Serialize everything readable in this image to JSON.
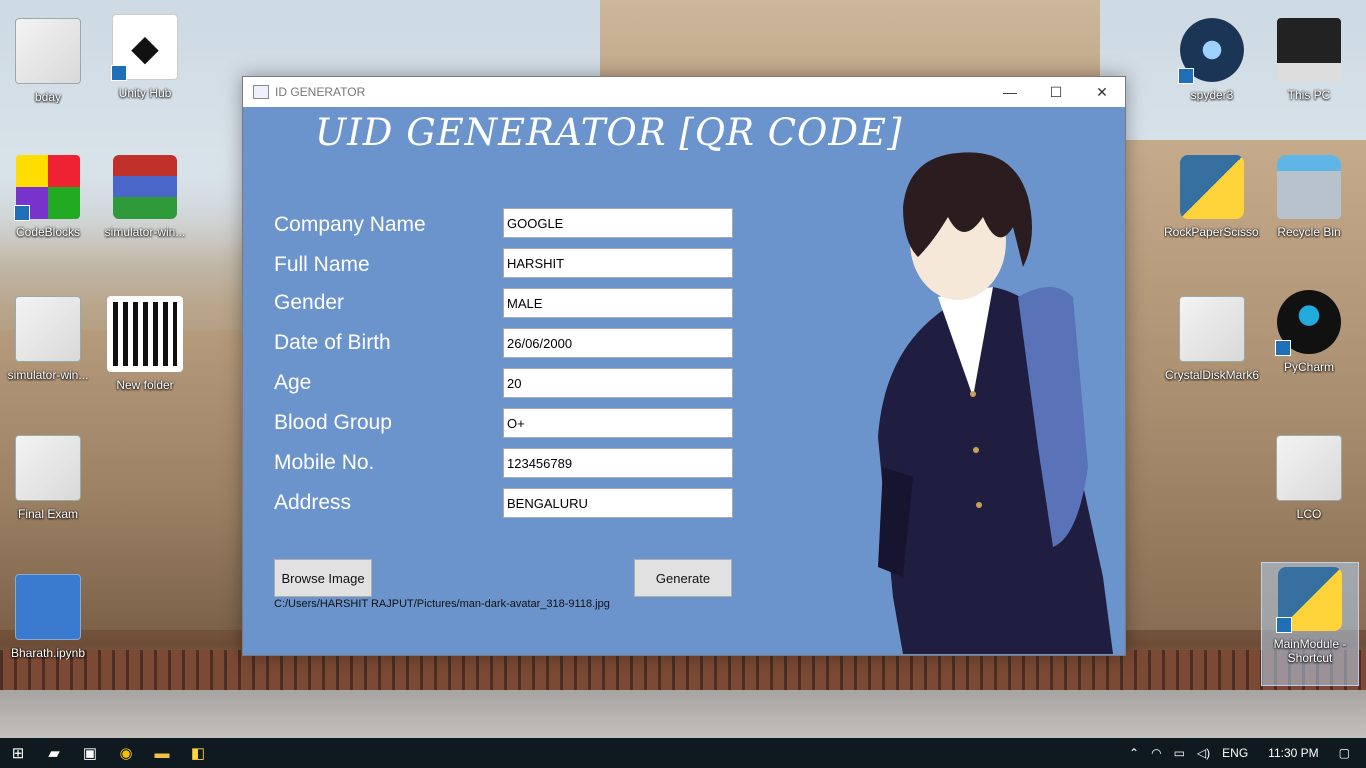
{
  "desktop": {
    "icons_left": [
      {
        "label": "bday",
        "icon": "file-icon"
      },
      {
        "label": "Unity Hub",
        "icon": "unity-icon"
      },
      {
        "label": "CodeBlocks",
        "icon": "codeblocks-icon"
      },
      {
        "label": "simulator-win...",
        "icon": "winrar-icon"
      },
      {
        "label": "simulator-win...",
        "icon": "unity-file-icon"
      },
      {
        "label": "New folder",
        "icon": "qr-file-icon"
      },
      {
        "label": "Final Exam",
        "icon": "file-icon"
      },
      {
        "label": "Bharath.ipynb",
        "icon": "ipynb-icon"
      }
    ],
    "icons_right": [
      {
        "label": "spyder3",
        "icon": "spyder-icon"
      },
      {
        "label": "This PC",
        "icon": "computer-icon"
      },
      {
        "label": "RockPaperScissor",
        "icon": "python-file-icon"
      },
      {
        "label": "Recycle Bin",
        "icon": "recycle-bin-icon"
      },
      {
        "label": "CrystalDiskMark6",
        "icon": "file-icon"
      },
      {
        "label": "PyCharm",
        "icon": "alien-icon"
      },
      {
        "label": "LCO",
        "icon": "file-icon"
      },
      {
        "label": "MainModule - Shortcut",
        "icon": "python-shortcut-icon"
      }
    ]
  },
  "window": {
    "title": "ID GENERATOR",
    "heading": "UID GENERATOR [QR CODE]",
    "fields": [
      {
        "label": "Company Name",
        "value": "GOOGLE"
      },
      {
        "label": "Full Name",
        "value": "HARSHIT"
      },
      {
        "label": "Gender",
        "value": "MALE"
      },
      {
        "label": "Date of Birth",
        "value": "26/06/2000"
      },
      {
        "label": "Age",
        "value": "20"
      },
      {
        "label": "Blood Group",
        "value": "O+"
      },
      {
        "label": "Mobile No.",
        "value": "123456789"
      },
      {
        "label": "Address",
        "value": "BENGALURU"
      }
    ],
    "browse_label": "Browse Image",
    "generate_label": "Generate",
    "image_path": "C:/Users/HARSHIT RAJPUT/Pictures/man-dark-avatar_318-9118.jpg",
    "controls": {
      "minimize": "—",
      "maximize": "☐",
      "close": "✕"
    }
  },
  "taskbar": {
    "language": "ENG",
    "time": "11:30 PM"
  },
  "colors": {
    "window_bg": "#6b94cd",
    "taskbar_bg": "#0f1920"
  }
}
